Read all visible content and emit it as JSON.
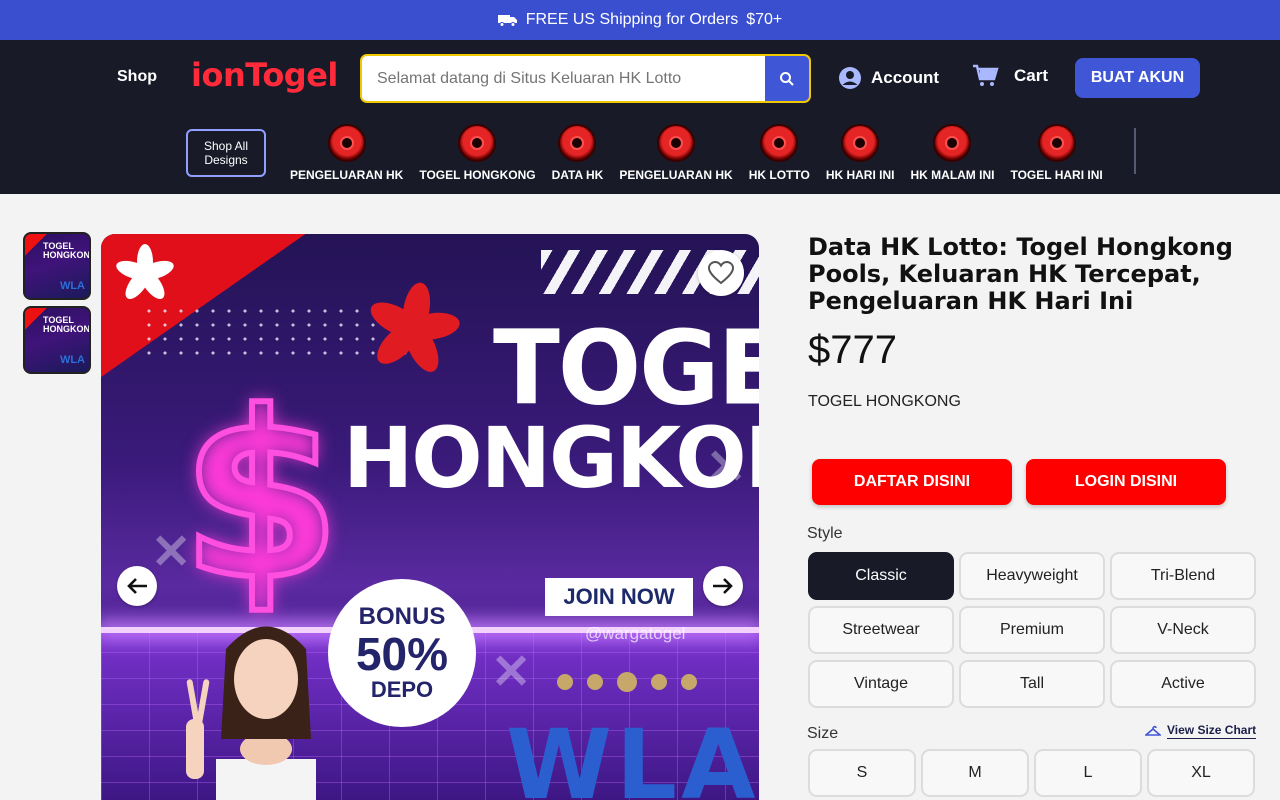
{
  "promo": {
    "text": "FREE US Shipping for Orders",
    "amount": "$70+"
  },
  "header": {
    "shop_label": "Shop",
    "logo": "ionTogel",
    "search_placeholder": "Selamat datang di Situs Keluaran HK Lotto",
    "account_label": "Account",
    "cart_label": "Cart",
    "cta_label": "BUAT AKUN",
    "shop_all_label": "Shop All Designs",
    "categories": [
      {
        "label": "PENGELUARAN HK"
      },
      {
        "label": "TOGEL HONGKONG"
      },
      {
        "label": "DATA HK"
      },
      {
        "label": "PENGELUARAN HK"
      },
      {
        "label": "HK LOTTO"
      },
      {
        "label": "HK HARI INI"
      },
      {
        "label": "HK MALAM INI"
      },
      {
        "label": "TOGEL HARI INI"
      }
    ]
  },
  "gallery": {
    "thumb_text": "TOGEL HONGKONG",
    "thumb_brand": "WLA",
    "banner": {
      "line1": "TOGEL",
      "line2": "HONGKONG",
      "join": "JOIN NOW",
      "handle": "@wargatogel",
      "bonus1": "BONUS",
      "bonus2": "50%",
      "bonus3": "DEPO",
      "brand": "WLA"
    }
  },
  "product": {
    "title": "Data HK Lotto: Togel Hongkong Pools, Keluaran HK Tercepat, Pengeluaran HK Hari Ini",
    "price": "$777",
    "vendor": "TOGEL HONGKONG",
    "register_label": "DAFTAR DISINI",
    "login_label": "LOGIN DISINI",
    "style_label": "Style",
    "styles": [
      "Classic",
      "Heavyweight",
      "Tri-Blend",
      "Streetwear",
      "Premium",
      "V-Neck",
      "Vintage",
      "Tall",
      "Active"
    ],
    "selected_style": "Classic",
    "size_label": "Size",
    "size_chart_label": "View Size Chart",
    "sizes": [
      "S",
      "M",
      "L",
      "XL"
    ]
  },
  "colors": {
    "promo_bg": "#3a4fd0",
    "header_bg": "#181a28",
    "accent_blue": "#3f57d6",
    "cta_red": "#ff0000",
    "logo_red": "#ff2a3a"
  }
}
